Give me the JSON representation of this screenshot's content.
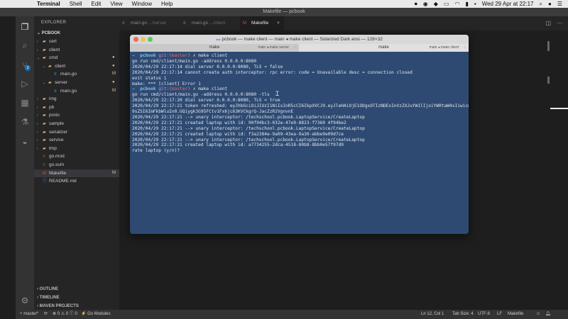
{
  "menubar": {
    "app": "Terminal",
    "items": [
      "Shell",
      "Edit",
      "View",
      "Window",
      "Help"
    ],
    "status": {
      "flag": "▪",
      "datetime": "Wed 29 Apr at 22:17"
    }
  },
  "window": {
    "title": "Makefile — pcbook"
  },
  "sidebar": {
    "header": "EXPLORER",
    "project": "PCBOOK",
    "items": [
      {
        "label": "cert",
        "kind": "folder",
        "depth": 1,
        "expanded": false,
        "mark": ""
      },
      {
        "label": "client",
        "kind": "folder",
        "depth": 1,
        "expanded": false,
        "mark": ""
      },
      {
        "label": "cmd",
        "kind": "folder",
        "depth": 1,
        "expanded": true,
        "mark": "●"
      },
      {
        "label": "client",
        "kind": "folder",
        "depth": 2,
        "expanded": true,
        "mark": "●"
      },
      {
        "label": "main.go",
        "kind": "go",
        "depth": 3,
        "expanded": false,
        "mark": "M"
      },
      {
        "label": "server",
        "kind": "folder",
        "depth": 2,
        "expanded": true,
        "mark": "●"
      },
      {
        "label": "main.go",
        "kind": "go",
        "depth": 3,
        "expanded": false,
        "mark": "M"
      },
      {
        "label": "img",
        "kind": "folder",
        "depth": 1,
        "expanded": false,
        "mark": ""
      },
      {
        "label": "pb",
        "kind": "folder",
        "depth": 1,
        "expanded": false,
        "mark": ""
      },
      {
        "label": "proto",
        "kind": "folder",
        "depth": 1,
        "expanded": false,
        "mark": ""
      },
      {
        "label": "sample",
        "kind": "folder",
        "depth": 1,
        "expanded": false,
        "mark": ""
      },
      {
        "label": "serializer",
        "kind": "folder",
        "depth": 1,
        "expanded": false,
        "mark": ""
      },
      {
        "label": "service",
        "kind": "folder",
        "depth": 1,
        "expanded": false,
        "mark": ""
      },
      {
        "label": "tmp",
        "kind": "folder",
        "depth": 1,
        "expanded": false,
        "mark": ""
      },
      {
        "label": "go.mod",
        "kind": "mod",
        "depth": 1,
        "expanded": false,
        "mark": ""
      },
      {
        "label": "go.sum",
        "kind": "mod",
        "depth": 1,
        "expanded": false,
        "mark": ""
      },
      {
        "label": "Makefile",
        "kind": "make",
        "depth": 1,
        "expanded": false,
        "mark": "M"
      },
      {
        "label": "README.md",
        "kind": "md",
        "depth": 1,
        "expanded": false,
        "mark": ""
      }
    ],
    "sections": [
      "OUTLINE",
      "TIMELINE",
      "MAVEN PROJECTS"
    ]
  },
  "tabs": [
    {
      "label": "main.go",
      "path": ".../server",
      "active": false
    },
    {
      "label": "main.go",
      "path": ".../client",
      "active": false
    },
    {
      "label": "Makefile",
      "path": "",
      "active": true
    }
  ],
  "terminal": {
    "title": "pcbook — make client — main ◂ make client — Solarized Dark ansi — 128×32",
    "tabs": [
      {
        "label": "make",
        "sub": "main ◂ make server"
      },
      {
        "label": "make",
        "sub": "main ◂ make client"
      }
    ],
    "lines": [
      {
        "type": "prompt",
        "dir": "pcbook",
        "git": "git:(",
        "branch": "master",
        "gitEnd": ")",
        "cmd": "make client"
      },
      {
        "type": "text",
        "text": "go run cmd/client/main.go -address 0.0.0.0:8080"
      },
      {
        "type": "text",
        "text": "2020/04/29 22:17:14 dial server 0.0.0.0:8080, TLS = false"
      },
      {
        "type": "text",
        "text": "2020/04/29 22:17:14 cannot create auth interceptor: rpc error: code = Unavailable desc = connection closed"
      },
      {
        "type": "text",
        "text": "exit status 1"
      },
      {
        "type": "text",
        "text": "make: *** [client] Error 1"
      },
      {
        "type": "prompt",
        "dir": "pcbook",
        "git": "git:(",
        "branch": "master",
        "gitEnd": ")",
        "cmd": "make client"
      },
      {
        "type": "text",
        "text": "go run cmd/client/main.go -address 0.0.0.0:8080 -tls"
      },
      {
        "type": "text",
        "text": "2020/04/29 22:17:20 dial server 0.0.0.0:8080, TLS = true"
      },
      {
        "type": "text",
        "text": "2020/04/29 22:17:21 token refreshed: eyJhbGciOiJIUzI1NiIsInR5cCI6IkpXVCJ9.eyJleHAiOjE1ODgxOTIzNDEsInVzZXJuYW1lIjoiYWRtaW4xIiwicm"
      },
      {
        "type": "text",
        "text": "9sZSI6ImFkbWluIn0.GQiygk3G95FCtv1Fx6jc63KVCkgrQ-JacZzR2VgnvnE"
      },
      {
        "type": "text",
        "text": "2020/04/29 22:17:21 --> unary interceptor: /techschool.pcbook.LaptopService/CreateLaptop"
      },
      {
        "type": "text",
        "text": "2020/04/29 22:17:21 created laptop with id: 90f94bc3-032e-47e9-8823-f7369 4f94be2"
      },
      {
        "type": "text",
        "text": "2020/04/29 22:17:21 --> unary interceptor: /techschool.pcbook.LaptopService/CreateLaptop"
      },
      {
        "type": "text",
        "text": "2020/04/29 22:17:21 created laptop with id: f3a2384e-9a09-43ea-9a30-ebbe9e09d7ce"
      },
      {
        "type": "text",
        "text": "2020/04/29 22:17:21 --> unary interceptor: /techschool.pcbook.LaptopService/CreateLaptop"
      },
      {
        "type": "text",
        "text": "2020/04/29 22:17:21 created laptop with id: a7734255-2dca-4518-80b8-8bb0e57f97d9"
      },
      {
        "type": "text",
        "text": "rate laptop (y/n)?"
      }
    ]
  },
  "statusbar": {
    "branch": "master*",
    "errors": "0",
    "warnings": "0",
    "info": "0",
    "gomodules": "Go Modules",
    "position": "Ln 12, Col 1",
    "tabsize": "Tab Size: 4",
    "encoding": "UTF-8",
    "eol": "LF",
    "language": "Makefile"
  },
  "colors": {
    "terminal_bg": "#2e4a72",
    "editor_bg": "#1e1e1e",
    "sidebar_bg": "#252526",
    "statusbar_bg": "#333333"
  }
}
